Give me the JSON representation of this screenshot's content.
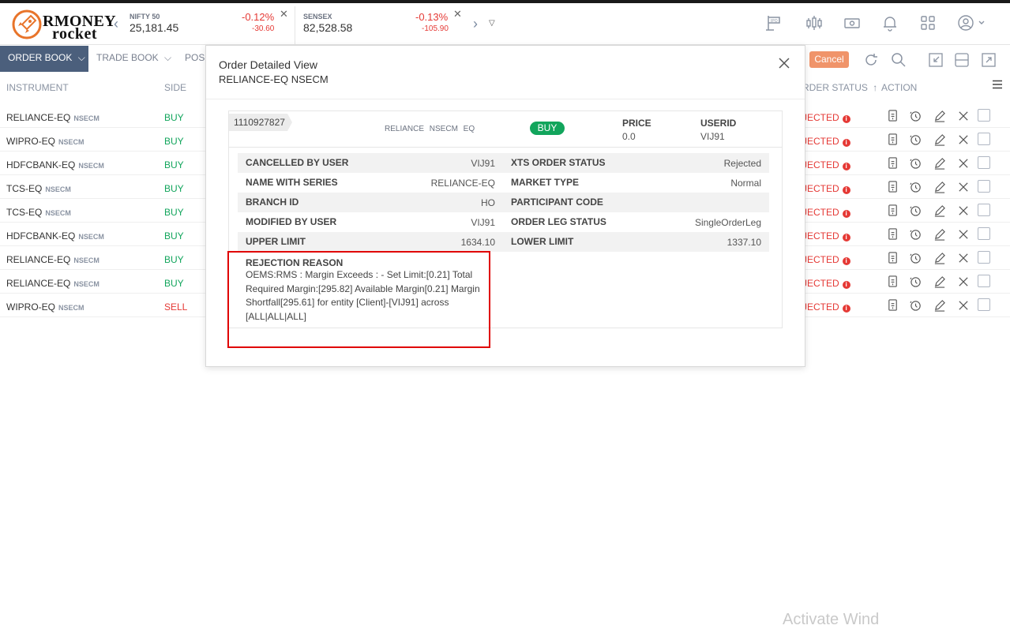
{
  "brand": {
    "line1": "RMONEY",
    "line2": "rocket"
  },
  "indices": [
    {
      "name": "NIFTY 50",
      "value": "25,181.45",
      "pct": "-0.12%",
      "change": "-30.60"
    },
    {
      "name": "SENSEX",
      "value": "82,528.58",
      "pct": "-0.13%",
      "change": "-105.90"
    }
  ],
  "header_icons": [
    "ipo-icon",
    "chart-candles-icon",
    "cash-icon",
    "bell-icon",
    "apps-grid-icon",
    "user-account-icon"
  ],
  "tabs": {
    "order_book": "ORDER BOOK",
    "trade_book": "TRADE BOOK",
    "positions": "POSI"
  },
  "toolbar": {
    "cancel_label": "Cancel"
  },
  "columns": {
    "instrument": "INSTRUMENT",
    "side": "SIDE",
    "status": "RDER STATUS",
    "action": "ACTION"
  },
  "orders": [
    {
      "symbol": "RELIANCE-EQ",
      "exchange": "NSECM",
      "side": "BUY",
      "status": "JECTED"
    },
    {
      "symbol": "WIPRO-EQ",
      "exchange": "NSECM",
      "side": "BUY",
      "status": "JECTED"
    },
    {
      "symbol": "HDFCBANK-EQ",
      "exchange": "NSECM",
      "side": "BUY",
      "status": "JECTED"
    },
    {
      "symbol": "TCS-EQ",
      "exchange": "NSECM",
      "side": "BUY",
      "status": "JECTED"
    },
    {
      "symbol": "TCS-EQ",
      "exchange": "NSECM",
      "side": "BUY",
      "status": "JECTED"
    },
    {
      "symbol": "HDFCBANK-EQ",
      "exchange": "NSECM",
      "side": "BUY",
      "status": "JECTED"
    },
    {
      "symbol": "RELIANCE-EQ",
      "exchange": "NSECM",
      "side": "BUY",
      "status": "JECTED"
    },
    {
      "symbol": "RELIANCE-EQ",
      "exchange": "NSECM",
      "side": "BUY",
      "status": "JECTED"
    },
    {
      "symbol": "WIPRO-EQ",
      "exchange": "NSECM",
      "side": "SELL",
      "status": "JECTED"
    }
  ],
  "colors": {
    "buy": "#12a55c",
    "sell": "#e53935",
    "rejected": "#e53935",
    "accent": "#4b5f7c",
    "cancel": "#f0946a",
    "highlight_box": "#e00000"
  },
  "modal": {
    "title": "Order Detailed View",
    "subtitle": "RELIANCE-EQ NSECM",
    "order_id": "1110927827",
    "symbol_line": "RELIANCE NSECM EQ",
    "side": "BUY",
    "price_label": "PRICE",
    "price_value": "0.0",
    "userid_label": "USERID",
    "userid_value": "VIJ91",
    "left_fields": [
      {
        "label": "CANCELLED BY USER",
        "value": "VIJ91"
      },
      {
        "label": "NAME WITH SERIES",
        "value": "RELIANCE-EQ"
      },
      {
        "label": "BRANCH ID",
        "value": "HO"
      },
      {
        "label": "MODIFIED BY USER",
        "value": "VIJ91"
      },
      {
        "label": "UPPER LIMIT",
        "value": "1634.10"
      }
    ],
    "right_fields": [
      {
        "label": "XTS ORDER STATUS",
        "value": "Rejected"
      },
      {
        "label": "MARKET TYPE",
        "value": "Normal"
      },
      {
        "label": "PARTICIPANT CODE",
        "value": ""
      },
      {
        "label": "ORDER LEG STATUS",
        "value": "SingleOrderLeg"
      },
      {
        "label": "LOWER LIMIT",
        "value": "1337.10"
      }
    ],
    "rejection_label": "REJECTION REASON",
    "rejection_text": "OEMS:RMS : Margin Exceeds : - Set Limit:[0.21] Total Required Margin:[295.82] Available Margin[0.21] Margin Shortfall[295.61] for entity [Client]-[VIJ91] across [ALL|ALL|ALL]"
  },
  "watermark": "Activate Wind"
}
